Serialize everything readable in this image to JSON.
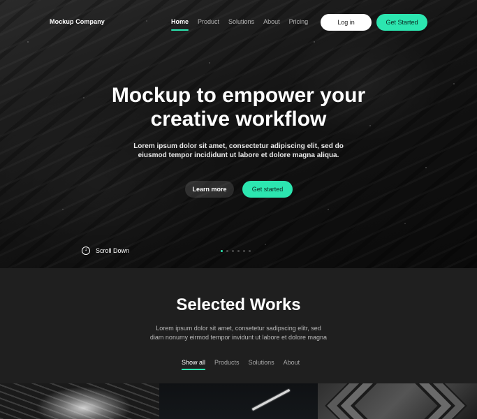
{
  "header": {
    "brand": "Mockup Company",
    "nav": [
      {
        "label": "Home",
        "active": true
      },
      {
        "label": "Product",
        "active": false
      },
      {
        "label": "Solutions",
        "active": false
      },
      {
        "label": "About",
        "active": false
      },
      {
        "label": "Pricing",
        "active": false
      }
    ],
    "login_label": "Log in",
    "get_started_label": "Get Started"
  },
  "hero": {
    "title_line1": "Mockup to empower your",
    "title_line2": "creative workflow",
    "subtitle_line1": "Lorem ipsum dolor sit amet, consectetur adipiscing elit, sed do",
    "subtitle_line2": "eiusmod tempor incididunt ut labore et dolore magna aliqua.",
    "learn_more_label": "Learn more",
    "get_started_label": "Get started",
    "scroll_label": "Scroll Down",
    "slides_total": 6,
    "slide_active": 1
  },
  "works": {
    "title": "Selected Works",
    "subtitle_line1": "Lorem ipsum dolor sit amet, consetetur sadipscing elitr, sed",
    "subtitle_line2": "diam nonumy eirmod tempor invidunt ut labore et dolore magna",
    "filters": [
      {
        "label": "Show all",
        "active": true
      },
      {
        "label": "Products",
        "active": false
      },
      {
        "label": "Solutions",
        "active": false
      },
      {
        "label": "About",
        "active": false
      }
    ]
  },
  "colors": {
    "accent": "#2ce6b0",
    "section_bg": "#1f1f1f"
  }
}
